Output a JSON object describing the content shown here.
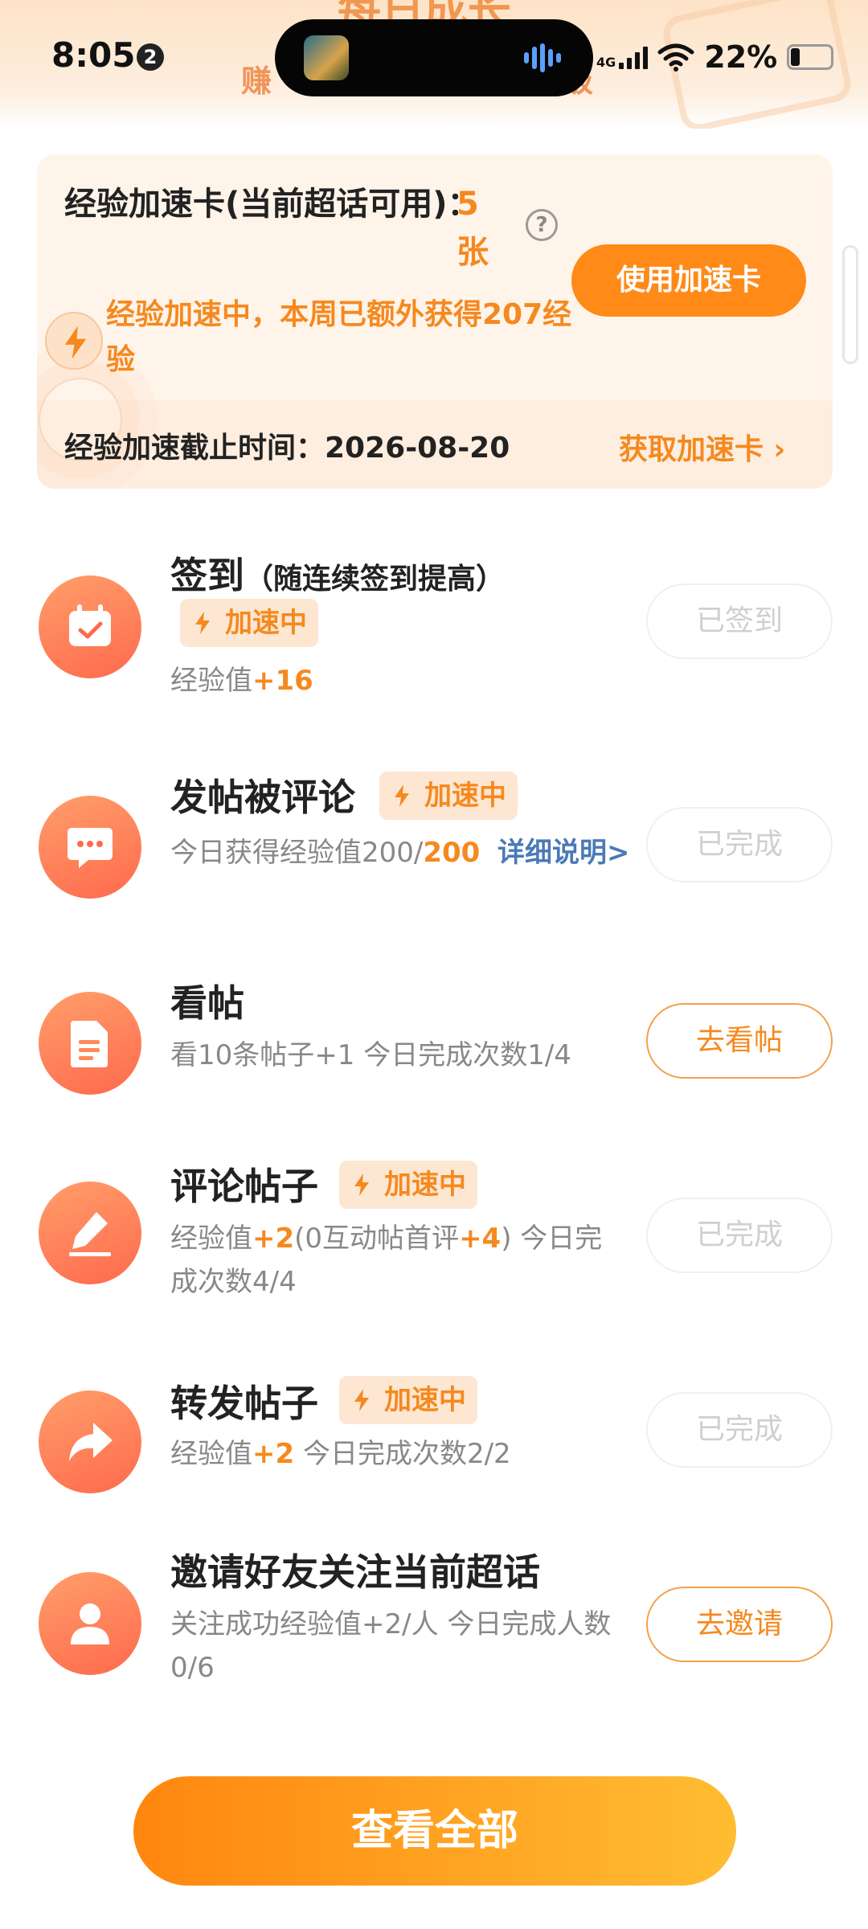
{
  "status_bar": {
    "time": "8:05",
    "notification_count": "2",
    "network": "4G",
    "battery_percent": "22%"
  },
  "header": {
    "title": "每日成长",
    "subtitle_left": "赚",
    "subtitle_right": "级"
  },
  "accel_card": {
    "title": "经验加速卡(当前超话可用)：",
    "count": "5张",
    "help": "?",
    "use_button": "使用加速卡",
    "status": "经验加速中，本周已额外获得207经验",
    "deadline": "经验加速截止时间：2026-08-20",
    "get_link": "获取加速卡 ›"
  },
  "tasks": [
    {
      "title": "签到",
      "note": "（随连续签到提高）",
      "tag": "加速中",
      "desc_prefix": "经验值",
      "desc_highlight": "+16",
      "button": "已签到",
      "icon": "calendar-check-icon"
    },
    {
      "title": "发帖被评论",
      "tag": "加速中",
      "desc_prefix": "今日获得经验值200/",
      "desc_highlight": "200",
      "desc_link": "详细说明>",
      "button": "已完成",
      "icon": "chat-bubble-icon"
    },
    {
      "title": "看帖",
      "desc": "看10条帖子+1  今日完成次数1/4",
      "button": "去看帖",
      "icon": "document-icon"
    },
    {
      "title": "评论帖子",
      "tag": "加速中",
      "desc_a": "经验值",
      "desc_b": "+2",
      "desc_c": "(0互动帖首评",
      "desc_d": "+4",
      "desc_e": ")  今日完成次数4/4",
      "button": "已完成",
      "icon": "pencil-icon"
    },
    {
      "title": "转发帖子",
      "tag": "加速中",
      "desc_a": "经验值",
      "desc_b": "+2",
      "desc_c": "  今日完成次数2/2",
      "button": "已完成",
      "icon": "share-arrow-icon"
    },
    {
      "title": "邀请好友关注当前超话",
      "desc": "关注成功经验值+2/人  今日完成人数0/6",
      "button": "去邀请",
      "icon": "person-icon"
    }
  ],
  "view_all_button": "查看全部",
  "colors": {
    "accent": "#f5891f",
    "button_orange": "#ff8a18",
    "link_blue": "#4a7ab8"
  }
}
